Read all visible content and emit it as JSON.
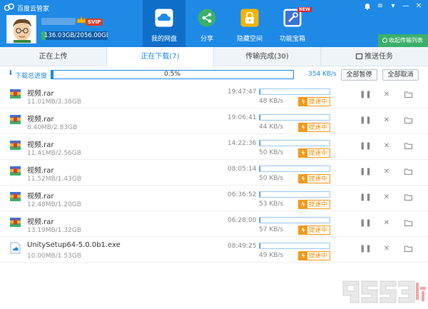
{
  "app": {
    "title": "百度云管家"
  },
  "account": {
    "vip_badge": "SVIP",
    "quota_text": "136.03GB/2056.00GB",
    "quota_used_fraction": 0.066
  },
  "nav": [
    {
      "label": "我的网盘",
      "icon": "cloud-drive-icon",
      "active": true
    },
    {
      "label": "分享",
      "icon": "share-icon",
      "active": false
    },
    {
      "label": "隐藏空间",
      "icon": "lock-icon",
      "active": false
    },
    {
      "label": "功能宝箱",
      "icon": "toolbox-icon",
      "active": false,
      "badge": "NEW"
    }
  ],
  "collapse_button": "收起传输列表",
  "tabs": [
    {
      "label": "正在上传",
      "active": false
    },
    {
      "label": "正在下载(7)",
      "active": true
    },
    {
      "label": "传输完成(30)",
      "active": false
    },
    {
      "label": "推送任务",
      "active": false
    }
  ],
  "summary": {
    "label": "下载总进度",
    "percent_text": "0.5%",
    "percent": 0.5,
    "speed": "354 KB/s",
    "pause_all": "全部暂停",
    "cancel_all": "全部取消"
  },
  "boost_label": "提速中",
  "files": [
    {
      "name": "视频.rar",
      "size": "11.01MB/3.38GB",
      "time": "19:47:47",
      "speed": "48 KB/s",
      "progress": 0.3,
      "type": "archive"
    },
    {
      "name": "视频.rar",
      "size": "8.40MB/2.83GB",
      "time": "19:06:41",
      "speed": "44 KB/s",
      "progress": 0.3,
      "type": "archive"
    },
    {
      "name": "视频.rar",
      "size": "11.41MB/2.56GB",
      "time": "14:22:36",
      "speed": "50 KB/s",
      "progress": 0.4,
      "type": "archive"
    },
    {
      "name": "视频.rar",
      "size": "11.52MB/1.43GB",
      "time": "08:05:14",
      "speed": "50 KB/s",
      "progress": 0.8,
      "type": "archive"
    },
    {
      "name": "视频.rar",
      "size": "12.48MB/1.20GB",
      "time": "06:36:52",
      "speed": "53 KB/s",
      "progress": 1.0,
      "type": "archive"
    },
    {
      "name": "视频.rar",
      "size": "13.19MB/1.32GB",
      "time": "06:28:00",
      "speed": "57 KB/s",
      "progress": 1.0,
      "type": "archive"
    },
    {
      "name": "UnitySetup64-5.0.0b1.exe",
      "size": "10.00MB/1.53GB",
      "time": "08:49:25",
      "speed": "49 KB/s",
      "progress": 0.6,
      "type": "exe"
    }
  ]
}
